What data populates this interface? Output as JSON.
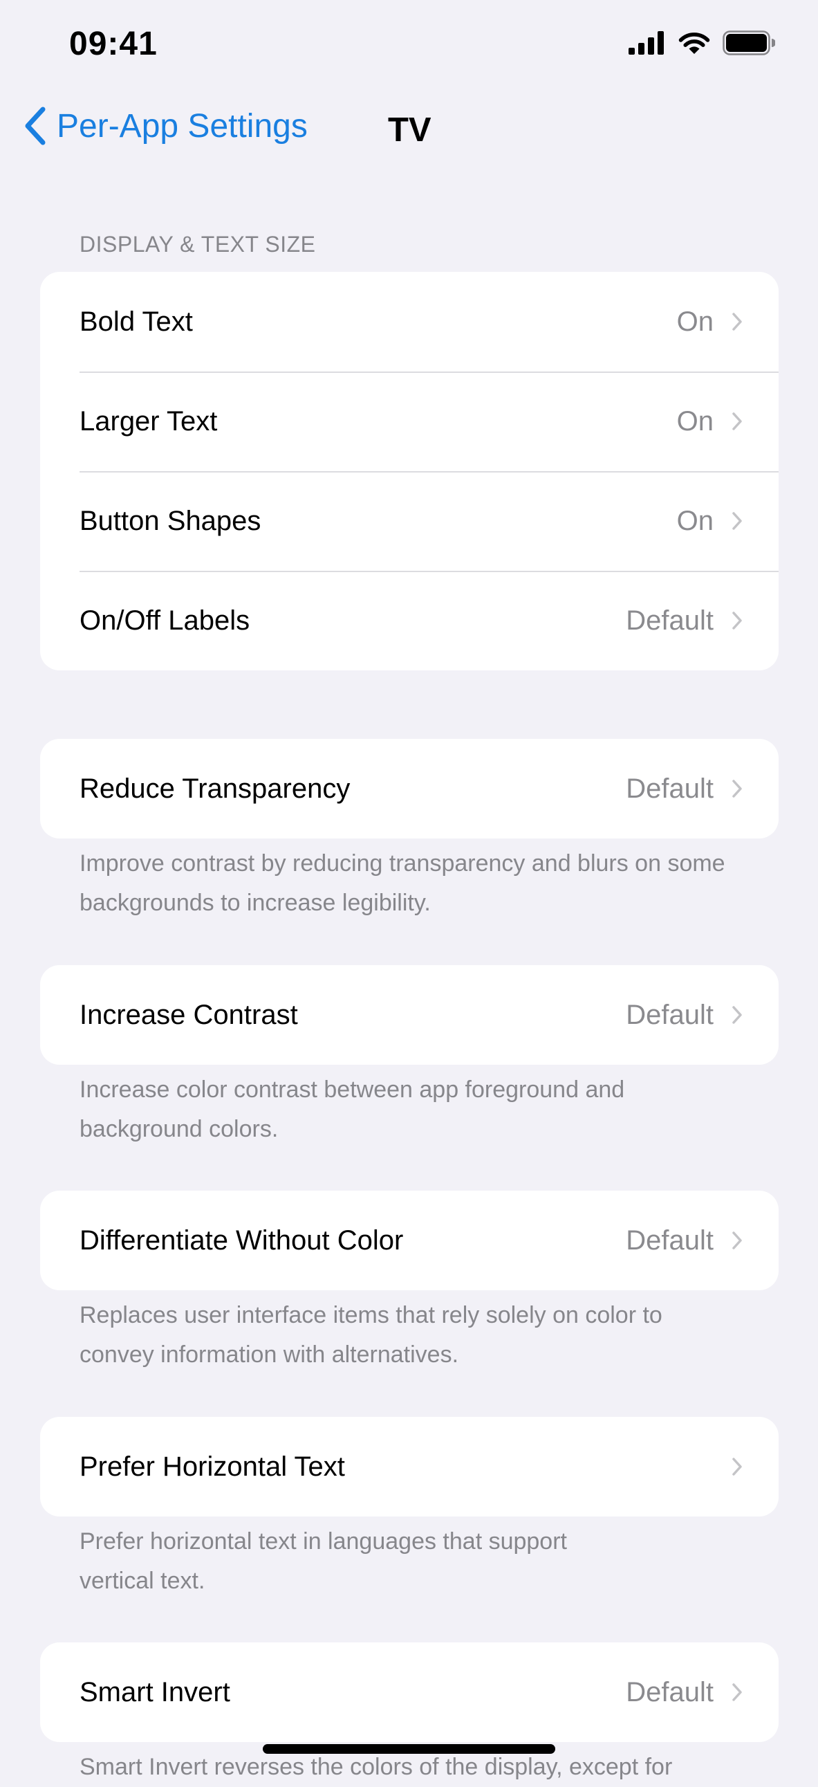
{
  "status_bar": {
    "time": "09:41"
  },
  "nav": {
    "back_label": "Per-App Settings",
    "title": "TV"
  },
  "sections": {
    "display_header": "DISPLAY & TEXT SIZE",
    "display_rows": [
      {
        "label": "Bold Text",
        "value": "On"
      },
      {
        "label": "Larger Text",
        "value": "On"
      },
      {
        "label": "Button Shapes",
        "value": "On"
      },
      {
        "label": "On/Off Labels",
        "value": "Default"
      }
    ],
    "reduce_transparency": {
      "label": "Reduce Transparency",
      "value": "Default",
      "footer": "Improve contrast by reducing transparency and blurs on some backgrounds to increase legibility."
    },
    "increase_contrast": {
      "label": "Increase Contrast",
      "value": "Default",
      "footer": "Increase color contrast between app foreground and background colors."
    },
    "differentiate_without_color": {
      "label": "Differentiate Without Color",
      "value": "Default",
      "footer": "Replaces user interface items that rely solely on color to convey information with alternatives."
    },
    "prefer_horizontal_text": {
      "label": "Prefer Horizontal Text",
      "value": "",
      "footer": "Prefer horizontal text in languages that support vertical text."
    },
    "smart_invert": {
      "label": "Smart Invert",
      "value": "Default",
      "footer": "Smart Invert reverses the colors of the display, except for"
    }
  },
  "colors": {
    "accent": "#1a7fe0",
    "background": "#f2f1f7",
    "secondary_text": "#86868b"
  }
}
